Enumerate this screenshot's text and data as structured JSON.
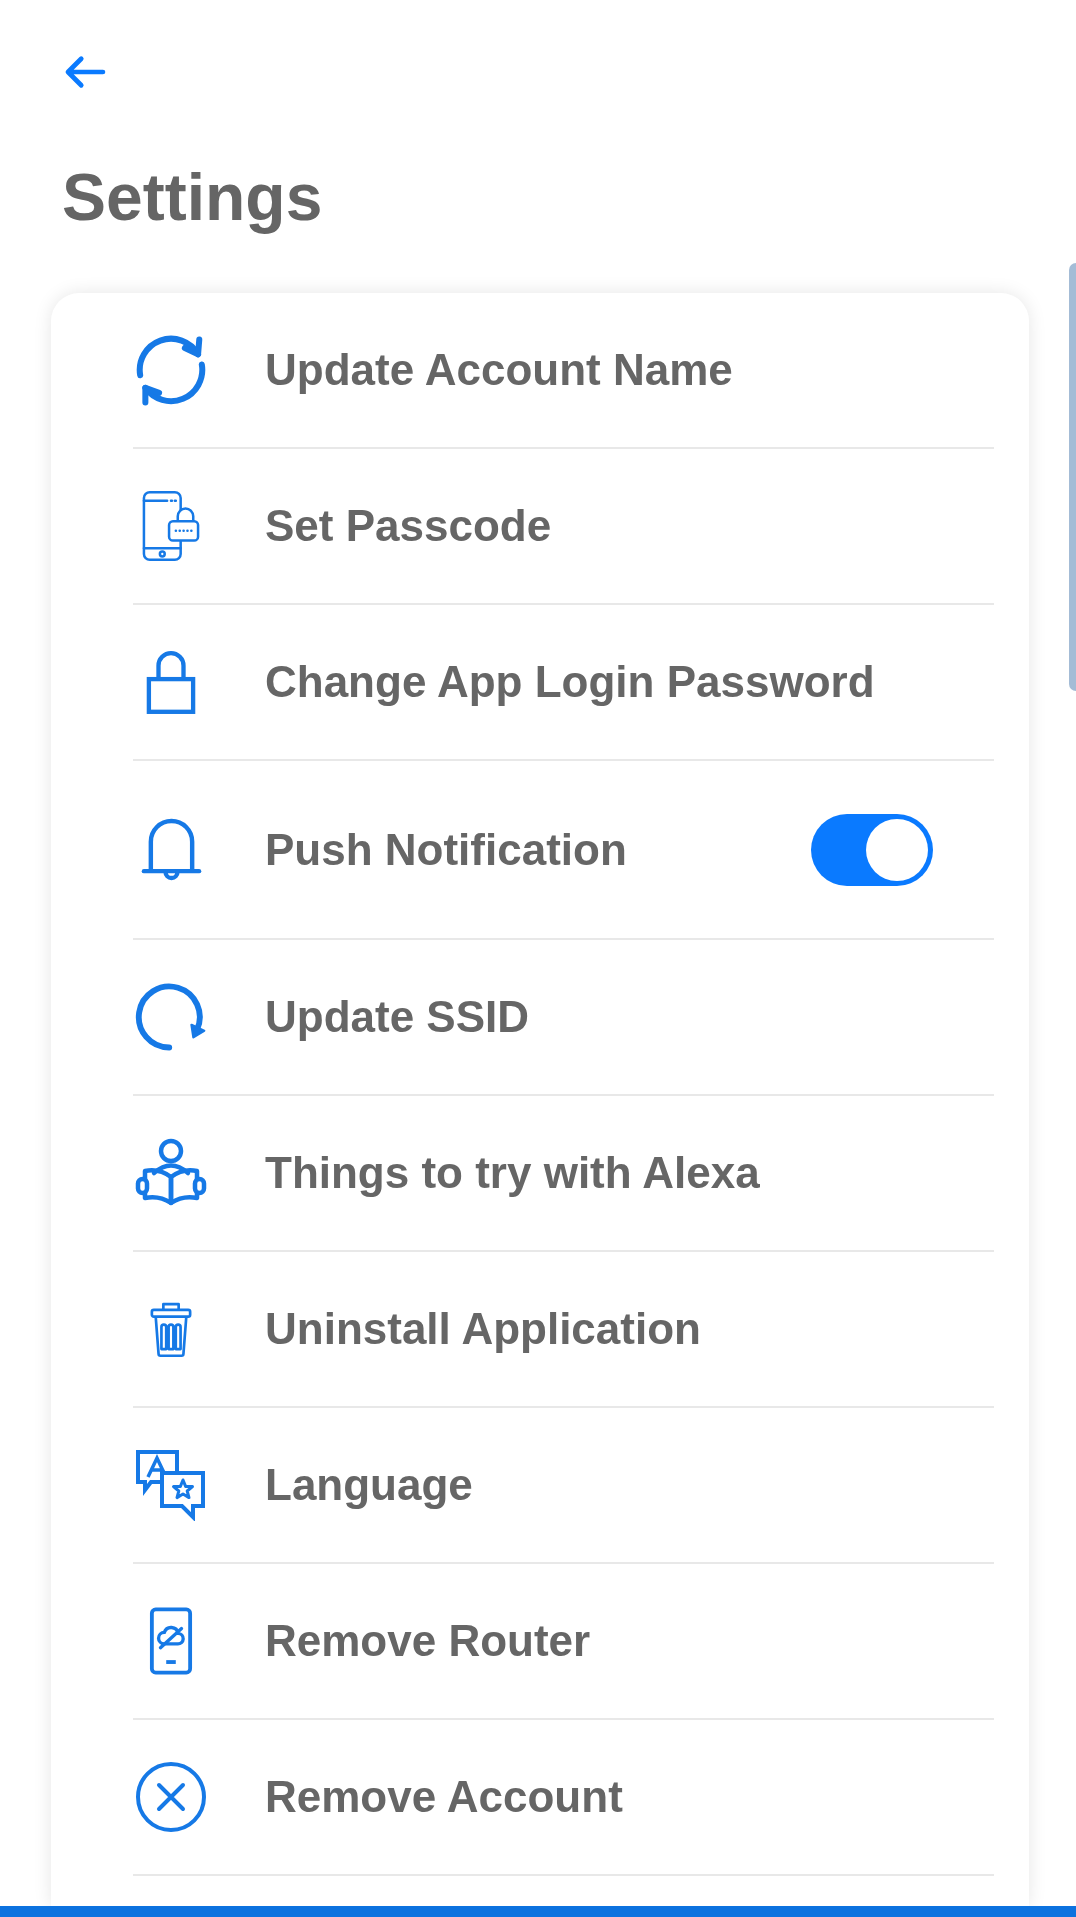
{
  "title": "Settings",
  "items": [
    {
      "kind": "link",
      "label": "Update Account Name"
    },
    {
      "kind": "link",
      "label": "Set Passcode"
    },
    {
      "kind": "link",
      "label": "Change App Login Password"
    },
    {
      "kind": "toggle",
      "label": "Push Notification",
      "on": true
    },
    {
      "kind": "link",
      "label": "Update SSID"
    },
    {
      "kind": "link",
      "label": "Things to try with Alexa"
    },
    {
      "kind": "link",
      "label": "Uninstall Application"
    },
    {
      "kind": "link",
      "label": "Language"
    },
    {
      "kind": "link",
      "label": "Remove Router"
    },
    {
      "kind": "link",
      "label": "Remove Account"
    }
  ]
}
